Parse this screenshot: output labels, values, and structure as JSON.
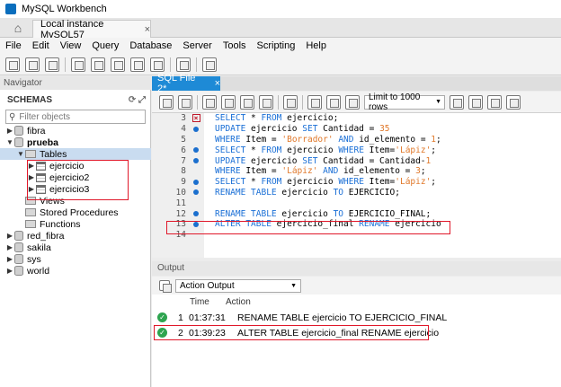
{
  "window": {
    "title": "MySQL Workbench"
  },
  "tabs": {
    "connection_tab": "Local instance MySQL57",
    "close": "×"
  },
  "menu": [
    "File",
    "Edit",
    "View",
    "Query",
    "Database",
    "Server",
    "Tools",
    "Scripting",
    "Help"
  ],
  "navigator": {
    "header": "Navigator",
    "schemas_label": "SCHEMAS",
    "filter_placeholder": "Filter objects",
    "tree": [
      {
        "label": "fibra",
        "level": 0,
        "expanded": false,
        "kind": "db"
      },
      {
        "label": "prueba",
        "level": 0,
        "expanded": true,
        "kind": "db",
        "bold": true
      },
      {
        "label": "Tables",
        "level": 1,
        "expanded": true,
        "kind": "folder",
        "selected": true
      },
      {
        "label": "ejercicio",
        "level": 2,
        "expanded": false,
        "kind": "table"
      },
      {
        "label": "ejercicio2",
        "level": 2,
        "expanded": false,
        "kind": "table"
      },
      {
        "label": "ejercicio3",
        "level": 2,
        "expanded": false,
        "kind": "table"
      },
      {
        "label": "Views",
        "level": 1,
        "kind": "folder"
      },
      {
        "label": "Stored Procedures",
        "level": 1,
        "kind": "folder"
      },
      {
        "label": "Functions",
        "level": 1,
        "kind": "folder"
      },
      {
        "label": "red_fibra",
        "level": 0,
        "expanded": false,
        "kind": "db"
      },
      {
        "label": "sakila",
        "level": 0,
        "expanded": false,
        "kind": "db"
      },
      {
        "label": "sys",
        "level": 0,
        "expanded": false,
        "kind": "db"
      },
      {
        "label": "world",
        "level": 0,
        "expanded": false,
        "kind": "db"
      }
    ]
  },
  "editor": {
    "tab_label": "SQL File 2*",
    "tab_close": "×",
    "limit_label": "Limit to 1000 rows",
    "lines": [
      {
        "n": "3",
        "marker": "error",
        "html": "<span class='kw'>SELECT</span> * <span class='kw'>FROM</span> ejercicio;"
      },
      {
        "n": "4",
        "marker": "dot",
        "html": "<span class='kw'>UPDATE</span> ejercicio <span class='kw'>SET</span> Cantidad = <span class='num'>35</span>"
      },
      {
        "n": "5",
        "marker": "",
        "html": "<span class='kw'>WHERE</span> Item = <span class='str'>'Borrador'</span> <span class='kw'>AND</span> id_elemento = <span class='num'>1</span>;"
      },
      {
        "n": "6",
        "marker": "dot",
        "html": "<span class='kw'>SELECT</span> * <span class='kw'>FROM</span> ejercicio <span class='kw'>WHERE</span> Item=<span class='str'>'Lápiz'</span>;"
      },
      {
        "n": "7",
        "marker": "dot",
        "html": "<span class='kw'>UPDATE</span> ejercicio <span class='kw'>SET</span> Cantidad = Cantidad-<span class='num'>1</span>"
      },
      {
        "n": "8",
        "marker": "",
        "html": "<span class='kw'>WHERE</span> Item = <span class='str'>'Lápiz'</span> <span class='kw'>AND</span> id_elemento = <span class='num'>3</span>;"
      },
      {
        "n": "9",
        "marker": "dot",
        "html": "<span class='kw'>SELECT</span> * <span class='kw'>FROM</span> ejercicio <span class='kw'>WHERE</span> Item=<span class='str'>'Lápiz'</span>;"
      },
      {
        "n": "10",
        "marker": "dot",
        "html": "<span class='kw'>RENAME TABLE</span> ejercicio <span class='kw'>TO</span> EJERCICIO;"
      },
      {
        "n": "11",
        "marker": "",
        "html": ""
      },
      {
        "n": "12",
        "marker": "dot",
        "html": "<span class='kw'>RENAME TABLE</span> ejercicio <span class='kw'>TO</span> EJERCICIO_FINAL;"
      },
      {
        "n": "13",
        "marker": "dot",
        "html": "<span class='kw'>ALTER TABLE</span> ejercicio_final <span class='kw'>RENAME</span> ejercicio"
      },
      {
        "n": "14",
        "marker": "",
        "html": ""
      }
    ]
  },
  "output": {
    "header": "Output",
    "selector": "Action Output",
    "columns": {
      "time": "Time",
      "action": "Action"
    },
    "rows": [
      {
        "num": "1",
        "time": "01:37:31",
        "action": "RENAME TABLE ejercicio TO EJERCICIO_FINAL"
      },
      {
        "num": "2",
        "time": "01:39:23",
        "action": "ALTER TABLE ejercicio_final RENAME ejercicio"
      }
    ]
  },
  "colors": {
    "accent": "#1e8ad6",
    "keyword": "#1a6fd6",
    "string": "#e0782a",
    "highlight_box": "#e0182a",
    "success": "#2ea44f"
  }
}
